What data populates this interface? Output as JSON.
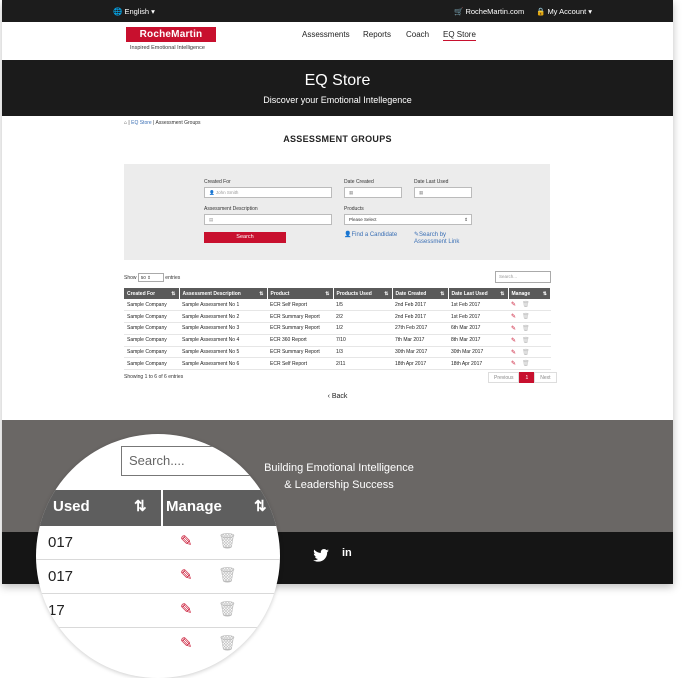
{
  "topbar": {
    "language": "English ▾",
    "shop": "RocheMartin.com",
    "account": "My Account ▾"
  },
  "nav": {
    "logo": "RocheMartin",
    "tagline": "Inspired Emotional Intelligence",
    "items": [
      "Assessments",
      "Reports",
      "Coach",
      "EQ Store"
    ]
  },
  "hero": {
    "title": "EQ Store",
    "subtitle": "Discover your Emotional Intellegence"
  },
  "breadcrumb": {
    "home": "⌂",
    "store": "EQ Store",
    "current": "Assessment Groups"
  },
  "page_title": "ASSESSMENT GROUPS",
  "filters": {
    "created_for_label": "Created For",
    "created_for_placeholder": "John Smith",
    "date_created_label": "Date Created",
    "date_last_used_label": "Date Last Used",
    "description_label": "Assessment Description",
    "products_label": "Products",
    "products_value": "Please Select",
    "search_button": "Search",
    "find_candidate": "Find a Candidate",
    "search_by_link": "Search by",
    "search_by_link2": "Assessment Link"
  },
  "table_controls": {
    "show": "Show",
    "entries_value": "50",
    "entries": "entries",
    "search_placeholder": "Search..."
  },
  "table": {
    "headers": [
      "Created For",
      "Assessment Description",
      "Product",
      "Products Used",
      "Date Created",
      "Date Last Used",
      "Manage"
    ],
    "rows": [
      [
        "Sample Company",
        "Sample Assessment No 1",
        "ECR Self Report",
        "1/5",
        "2nd Feb 2017",
        "1st Feb 2017"
      ],
      [
        "Sample Company",
        "Sample Assessment No 2",
        "ECR Summary Report",
        "2/2",
        "2nd Feb 2017",
        "1st Feb 2017"
      ],
      [
        "Sample Company",
        "Sample Assessment No 3",
        "ECR Summary Report",
        "1/2",
        "27th Feb 2017",
        "6th Mar 2017"
      ],
      [
        "Sample Company",
        "Sample Assessment No 4",
        "ECR 360 Report",
        "7/10",
        "7th Mar 2017",
        "8th Mar 2017"
      ],
      [
        "Sample Company",
        "Sample Assessment No 5",
        "ECR Summary Report",
        "1/3",
        "30th Mar 2017",
        "30th Mar 2017"
      ],
      [
        "Sample Company",
        "Sample Assessment No 6",
        "ECR Self Report",
        "2/11",
        "18th Apr 2017",
        "18th Apr 2017"
      ]
    ]
  },
  "table_info": "Showing 1 to 6 of 6 entries",
  "pager": {
    "prev": "Previous",
    "page": "1",
    "next": "Next"
  },
  "back": "Back",
  "footer": {
    "line1": "Building Emotional Intelligence",
    "line2": "& Leadership Success",
    "linkedin": "in"
  },
  "magnifier": {
    "search_placeholder": "Search....",
    "col_used": "Used",
    "col_manage": "Manage",
    "rows": [
      "017",
      "017",
      "17"
    ]
  },
  "colors": {
    "brand_red": "#c8102e",
    "dark": "#1b1b1b",
    "link": "#3a6fb5"
  }
}
